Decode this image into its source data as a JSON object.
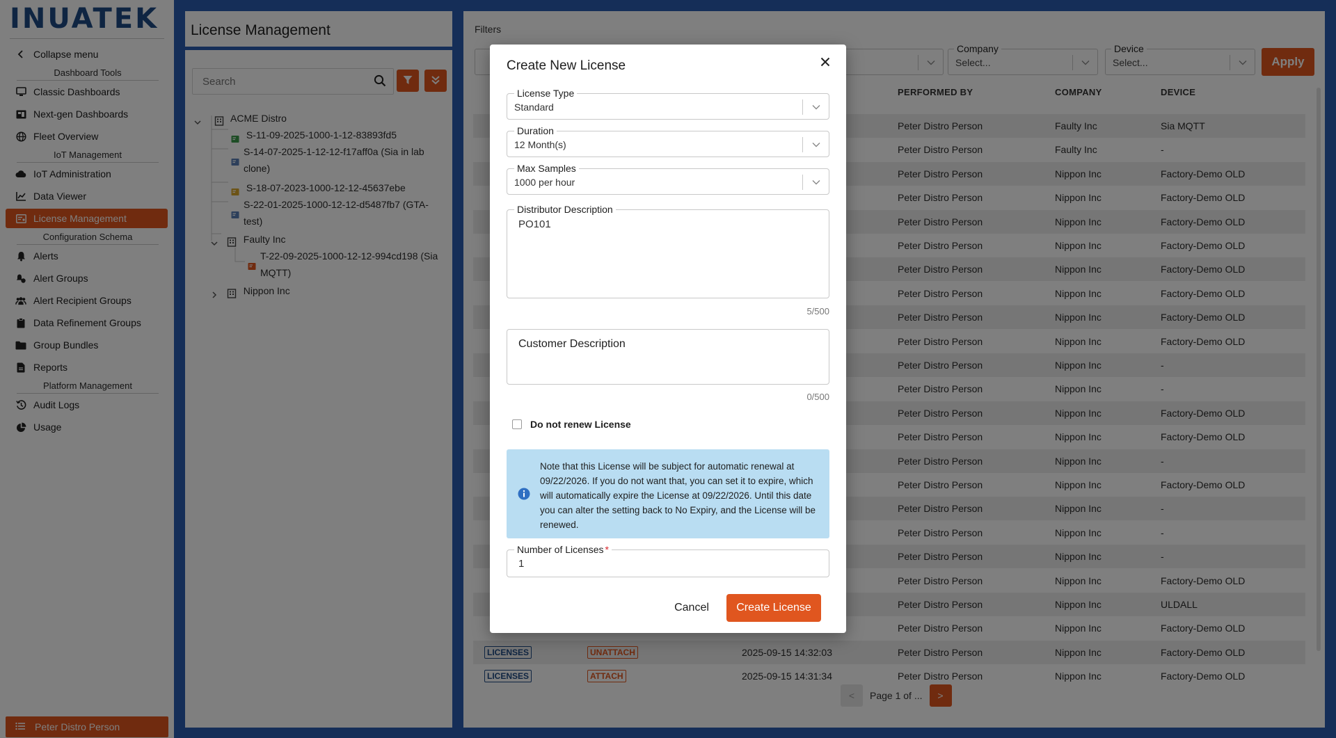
{
  "app": {
    "logo": "INUATEK",
    "user_name": "Peter Distro Person"
  },
  "sidebar": {
    "collapse_label": "Collapse menu",
    "sections": {
      "dashboard_tools": "Dashboard Tools",
      "iot_management": "IoT Management",
      "configuration_schema": "Configuration Schema",
      "platform_management": "Platform Management"
    },
    "items": [
      {
        "label": "Classic Dashboards",
        "icon": "monitor-icon"
      },
      {
        "label": "Next-gen Dashboards",
        "icon": "dashboard-icon"
      },
      {
        "label": "Fleet Overview",
        "icon": "globe-icon"
      },
      {
        "label": "IoT Administration",
        "icon": "cloud-icon"
      },
      {
        "label": "Data Viewer",
        "icon": "chart-icon"
      },
      {
        "label": "License Management",
        "icon": "license-icon",
        "active": true
      },
      {
        "label": "Alerts",
        "icon": "bell-icon"
      },
      {
        "label": "Alert Groups",
        "icon": "alert-group-icon"
      },
      {
        "label": "Alert Recipient Groups",
        "icon": "users-icon"
      },
      {
        "label": "Data Refinement Groups",
        "icon": "clipboard-icon"
      },
      {
        "label": "Group Bundles",
        "icon": "folder-icon"
      },
      {
        "label": "Reports",
        "icon": "report-icon"
      },
      {
        "label": "Audit Logs",
        "icon": "history-icon"
      },
      {
        "label": "Usage",
        "icon": "pie-icon"
      }
    ]
  },
  "tree_panel": {
    "title": "License Management",
    "search_placeholder": "Search",
    "nodes": [
      {
        "label": "ACME Distro"
      },
      {
        "label": "S-11-09-2025-1000-1-12-83893fd5"
      },
      {
        "label": "S-14-07-2025-1-12-12-f17aff0a (Sia in lab",
        "label2": "clone)"
      },
      {
        "label": "S-18-07-2023-1000-12-12-45637ebe"
      },
      {
        "label": "S-22-01-2025-1000-12-12-d5487fb7 (GTA-",
        "label2": "test)"
      },
      {
        "label": "Faulty Inc"
      },
      {
        "label": "T-22-09-2025-1000-12-12-994cd198 (Sia",
        "label2": "MQTT)"
      },
      {
        "label": "Nippon Inc"
      }
    ]
  },
  "main": {
    "filters_label": "Filters",
    "filters": {
      "company_label": "Company",
      "company_value": "Select...",
      "device_label": "Device",
      "device_value": "Select...",
      "apply_label": "Apply"
    },
    "columns": {
      "performed_by": "PERFORMED BY",
      "company": "COMPANY",
      "device": "DEVICE"
    },
    "rows": [
      {
        "performed_by": "Peter Distro Person",
        "company": "Faulty Inc",
        "device": "Sia MQTT"
      },
      {
        "performed_by": "Peter Distro Person",
        "company": "Faulty Inc",
        "device": "-"
      },
      {
        "performed_by": "Peter Distro Person",
        "company": "Nippon Inc",
        "device": "Factory-Demo OLD"
      },
      {
        "performed_by": "Peter Distro Person",
        "company": "Nippon Inc",
        "device": "Factory-Demo OLD"
      },
      {
        "performed_by": "Peter Distro Person",
        "company": "Nippon Inc",
        "device": "Factory-Demo OLD"
      },
      {
        "performed_by": "Peter Distro Person",
        "company": "Nippon Inc",
        "device": "Factory-Demo OLD"
      },
      {
        "performed_by": "Peter Distro Person",
        "company": "Nippon Inc",
        "device": "Factory-Demo OLD"
      },
      {
        "performed_by": "Peter Distro Person",
        "company": "Nippon Inc",
        "device": "Factory-Demo OLD"
      },
      {
        "performed_by": "Peter Distro Person",
        "company": "Nippon Inc",
        "device": "Factory-Demo OLD"
      },
      {
        "performed_by": "Peter Distro Person",
        "company": "Nippon Inc",
        "device": "Factory-Demo OLD"
      },
      {
        "performed_by": "Peter Distro Person",
        "company": "Nippon Inc",
        "device": "-"
      },
      {
        "performed_by": "Peter Distro Person",
        "company": "Nippon Inc",
        "device": "-"
      },
      {
        "performed_by": "Peter Distro Person",
        "company": "Nippon Inc",
        "device": "Factory-Demo OLD"
      },
      {
        "performed_by": "Peter Distro Person",
        "company": "Nippon Inc",
        "device": "Factory-Demo OLD"
      },
      {
        "performed_by": "Peter Distro Person",
        "company": "Nippon Inc",
        "device": "-"
      },
      {
        "performed_by": "Peter Distro Person",
        "company": "Nippon Inc",
        "device": "Factory-Demo OLD"
      },
      {
        "performed_by": "Peter Distro Person",
        "company": "Nippon Inc",
        "device": "-"
      },
      {
        "performed_by": "Peter Distro Person",
        "company": "Nippon Inc",
        "device": "-"
      },
      {
        "performed_by": "Peter Distro Person",
        "company": "Nippon Inc",
        "device": "-"
      },
      {
        "performed_by": "Peter Distro Person",
        "company": "Nippon Inc",
        "device": "Factory-Demo OLD"
      },
      {
        "performed_by": "Peter Distro Person",
        "company": "Nippon Inc",
        "device": "ULDALL"
      },
      {
        "performed_by": "Peter Distro Person",
        "company": "Nippon Inc",
        "device": "Factory-Demo OLD"
      },
      {
        "category": "LICENSES",
        "action": "UNATTACH",
        "date": "2025-09-15 14:32:03",
        "performed_by": "Peter Distro Person",
        "company": "Nippon Inc",
        "device": "Factory-Demo OLD"
      },
      {
        "category": "LICENSES",
        "action": "ATTACH",
        "date": "2025-09-15 14:31:34",
        "performed_by": "Peter Distro Person",
        "company": "Nippon Inc",
        "device": "Factory-Demo OLD"
      }
    ],
    "pager": {
      "prev": "<",
      "text": "Page 1 of ...",
      "next": ">"
    }
  },
  "modal": {
    "title": "Create New License",
    "license_type": {
      "label": "License Type",
      "value": "Standard"
    },
    "duration": {
      "label": "Duration",
      "value": "12 Month(s)"
    },
    "max_samples": {
      "label": "Max Samples",
      "value": "1000 per hour"
    },
    "distributor_description": {
      "label": "Distributor Description",
      "value": "PO101",
      "count": "5/500"
    },
    "customer_description": {
      "label": "Customer Description",
      "value": "",
      "count": "0/500"
    },
    "do_not_renew_label": "Do not renew License",
    "do_not_renew_checked": false,
    "info_text": "Note that this License will be subject for automatic renewal at 09/22/2026. If you do not want that, you can set it to expire, which will automatically expire the License at 09/22/2026. Until this date you can alter the setting back to No Expiry, and the License will be renewed.",
    "number_of_licenses": {
      "label": "Number of Licenses",
      "required_mark": "*",
      "value": "1"
    },
    "cancel_label": "Cancel",
    "create_label": "Create License"
  },
  "colors": {
    "accent": "#e0561f",
    "brand_blue": "#1f4b85",
    "frame_blue": "#2a5db0",
    "info_bg": "#b9ddf2"
  }
}
